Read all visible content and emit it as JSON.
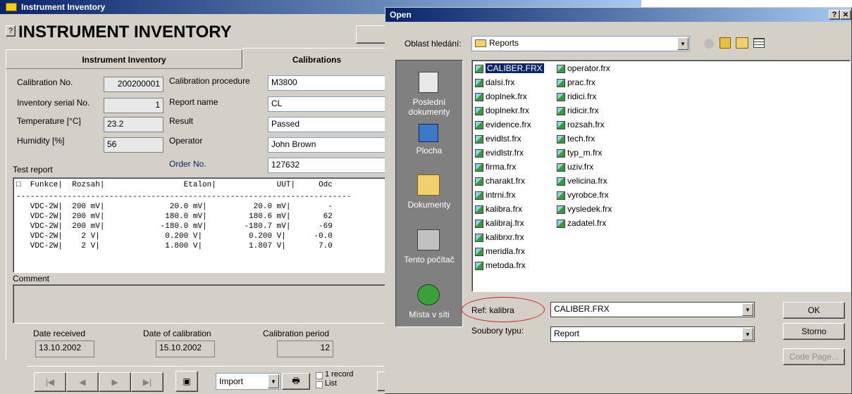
{
  "main_window": {
    "title": "Instrument Inventory",
    "header": "INSTRUMENT INVENTORY",
    "help_glyph": "?",
    "tabs": [
      "Instrument Inventory",
      "Calibrations"
    ],
    "fields": {
      "calibration_no": {
        "label": "Calibration No.",
        "value": "200200001"
      },
      "inventory_serial": {
        "label": "Inventory serial No.",
        "value": "1"
      },
      "temperature": {
        "label": "Temperature  [°C]",
        "value": "23.2"
      },
      "humidity": {
        "label": "Humidity  [%]",
        "value": "56"
      },
      "calibration_procedure": {
        "label": "Calibration procedure",
        "value": "M3800"
      },
      "report_name": {
        "label": "Report name",
        "value": "CL"
      },
      "result": {
        "label": "Result",
        "value": "Passed"
      },
      "operator": {
        "label": "Operator",
        "value": "John Brown"
      },
      "order_no": {
        "label": "Order No.",
        "value": "127632"
      }
    },
    "test_report_label": "Test report",
    "report_lines": [
      "□  Funkce|  Rozsah|                 Etalon|             UUT|     Odc",
      "------------------------------------------------------------------------",
      "   VDC-2W|  200 mV|              20.0 mV|          20.0 mV|        -",
      "   VDC-2W|  200 mV|             180.0 mV|         180.6 mV|       62",
      "   VDC-2W|  200 mV|            -180.0 mV|        -180.7 mV|      -69",
      "   VDC-2W|    2 V|              0.200 V|          0.200 V|      -0.0",
      "   VDC-2W|    2 V|              1.800 V|          1.807 V|       7.0"
    ],
    "comment_label": "Comment",
    "date_received": {
      "label": "Date received",
      "value": "13.10.2002"
    },
    "date_of_calibration": {
      "label": "Date of calibration",
      "value": "15.10.2002"
    },
    "calibration_period": {
      "label": "Calibration period",
      "value": "12"
    },
    "import_select": "Import",
    "record_text_1": "1 record",
    "record_text_2": "List"
  },
  "dialog": {
    "title": "Open",
    "help_button": "?",
    "close_button": "✕",
    "look_in_label": "Oblast hledání:",
    "look_in_value": "Reports",
    "places": [
      "Poslední dokumenty",
      "Plocha",
      "Dokumenty",
      "Tento počítač",
      "Místa v síti"
    ],
    "files_col1": [
      "CALIBER.FRX",
      "dalsi.frx",
      "doplnek.frx",
      "doplnekr.frx",
      "evidence.frx",
      "evidlst.frx",
      "evidlstr.frx",
      "firma.frx",
      "charakt.frx",
      "intrni.frx",
      "kalibra.frx",
      "kalibraj.frx",
      "kalibrxr.frx",
      "meridla.frx",
      "metoda.frx"
    ],
    "files_col2": [
      "operator.frx",
      "prac.frx",
      "ridici.frx",
      "ridicir.frx",
      "rozsah.frx",
      "tech.frx",
      "typ_m.frx",
      "uziv.frx",
      "velicina.frx",
      "vyrobce.frx",
      "vysledek.frx",
      "zadatel.frx"
    ],
    "filename_label": "Ref: kalibra",
    "filename_value": "CALIBER.FRX",
    "filetype_label": "Soubory typu:",
    "filetype_value": "Report",
    "ok_button": "OK",
    "cancel_button": "Storno",
    "codepage_button": "Code Page..."
  }
}
